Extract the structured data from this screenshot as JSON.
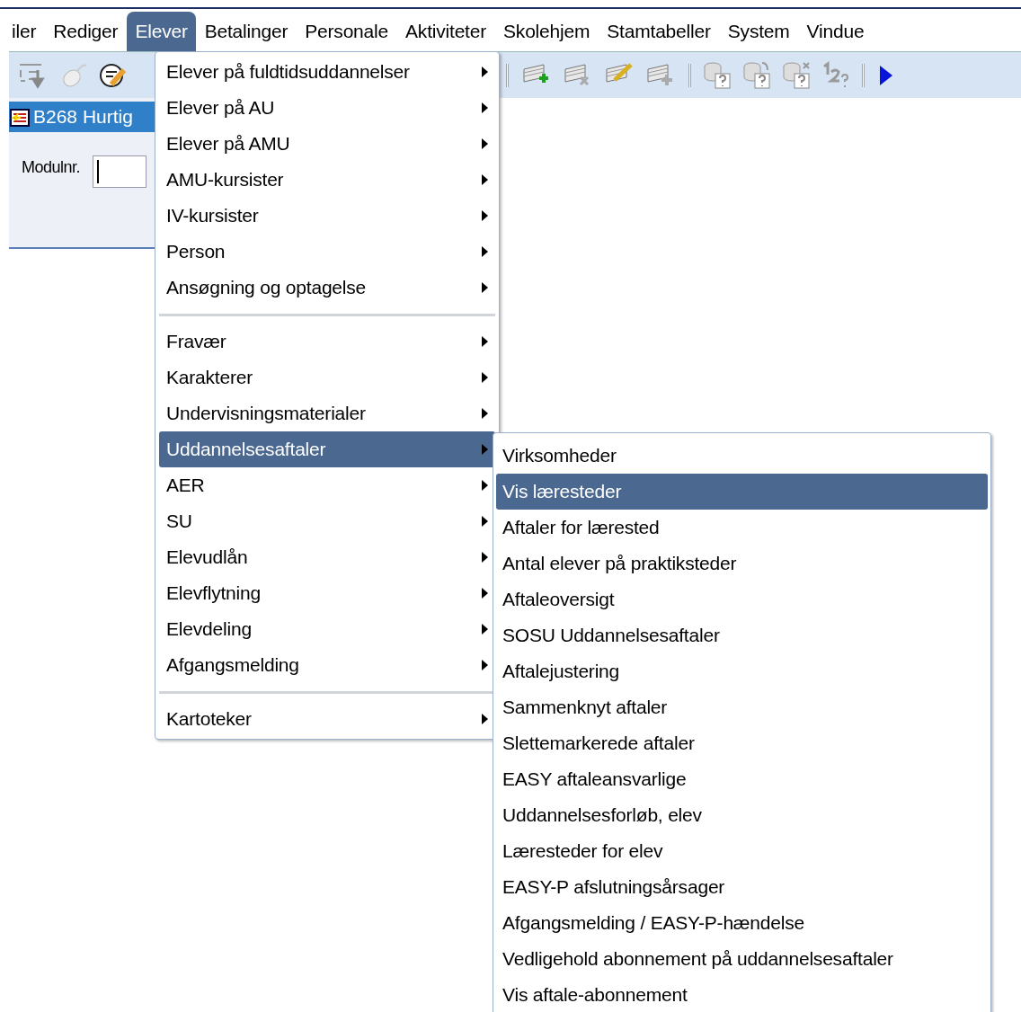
{
  "menubar": {
    "items": [
      {
        "label": "iler",
        "selected": false
      },
      {
        "label": "Rediger",
        "selected": false
      },
      {
        "label": "Elever",
        "selected": true
      },
      {
        "label": "Betalinger",
        "selected": false
      },
      {
        "label": "Personale",
        "selected": false
      },
      {
        "label": "Aktiviteter",
        "selected": false
      },
      {
        "label": "Skolehjem",
        "selected": false
      },
      {
        "label": "Stamtabeller",
        "selected": false
      },
      {
        "label": "System",
        "selected": false
      },
      {
        "label": "Vindue",
        "selected": false
      }
    ]
  },
  "window": {
    "title": "B268 Hurtig",
    "field_label": "Modulnr."
  },
  "menu": {
    "items": [
      {
        "kind": "item",
        "label": "Elever på fuldtidsuddannelser",
        "has_submenu": true,
        "selected": false
      },
      {
        "kind": "item",
        "label": "Elever på AU",
        "has_submenu": true,
        "selected": false
      },
      {
        "kind": "item",
        "label": "Elever på AMU",
        "has_submenu": true,
        "selected": false
      },
      {
        "kind": "item",
        "label": "AMU-kursister",
        "has_submenu": true,
        "selected": false
      },
      {
        "kind": "item",
        "label": "IV-kursister",
        "has_submenu": true,
        "selected": false
      },
      {
        "kind": "item",
        "label": "Person",
        "has_submenu": true,
        "selected": false
      },
      {
        "kind": "item",
        "label": "Ansøgning og optagelse",
        "has_submenu": true,
        "selected": false
      },
      {
        "kind": "separator"
      },
      {
        "kind": "item",
        "label": "Fravær",
        "has_submenu": true,
        "selected": false
      },
      {
        "kind": "item",
        "label": "Karakterer",
        "has_submenu": true,
        "selected": false
      },
      {
        "kind": "item",
        "label": "Undervisningsmaterialer",
        "has_submenu": true,
        "selected": false
      },
      {
        "kind": "item",
        "label": "Uddannelsesaftaler",
        "has_submenu": true,
        "selected": true
      },
      {
        "kind": "item",
        "label": "AER",
        "has_submenu": true,
        "selected": false
      },
      {
        "kind": "item",
        "label": "SU",
        "has_submenu": true,
        "selected": false
      },
      {
        "kind": "item",
        "label": "Elevudlån",
        "has_submenu": true,
        "selected": false
      },
      {
        "kind": "item",
        "label": "Elevflytning",
        "has_submenu": true,
        "selected": false
      },
      {
        "kind": "item",
        "label": "Elevdeling",
        "has_submenu": true,
        "selected": false
      },
      {
        "kind": "item",
        "label": "Afgangsmelding",
        "has_submenu": true,
        "selected": false
      },
      {
        "kind": "separator"
      },
      {
        "kind": "item",
        "label": "Kartoteker",
        "has_submenu": true,
        "selected": false
      }
    ]
  },
  "submenu": {
    "items": [
      {
        "label": "Virksomheder",
        "selected": false
      },
      {
        "label": "Vis læresteder",
        "selected": true
      },
      {
        "label": "Aftaler for lærested",
        "selected": false
      },
      {
        "label": "Antal elever på praktiksteder",
        "selected": false
      },
      {
        "label": "Aftaleoversigt",
        "selected": false
      },
      {
        "label": "SOSU Uddannelsesaftaler",
        "selected": false
      },
      {
        "label": "Aftalejustering",
        "selected": false
      },
      {
        "label": "Sammenknyt aftaler",
        "selected": false
      },
      {
        "label": "Slettemarkerede aftaler",
        "selected": false
      },
      {
        "label": "EASY aftaleansvarlige",
        "selected": false
      },
      {
        "label": "Uddannelsesforløb, elev",
        "selected": false
      },
      {
        "label": "Læresteder for elev",
        "selected": false
      },
      {
        "label": "EASY-P afslutningsårsager",
        "selected": false
      },
      {
        "label": "Afgangsmelding / EASY-P-hændelse",
        "selected": false
      },
      {
        "label": "Vedligehold abonnement på uddannelsesaftaler",
        "selected": false
      },
      {
        "label": "Vis aftale-abonnement",
        "selected": false
      }
    ]
  }
}
